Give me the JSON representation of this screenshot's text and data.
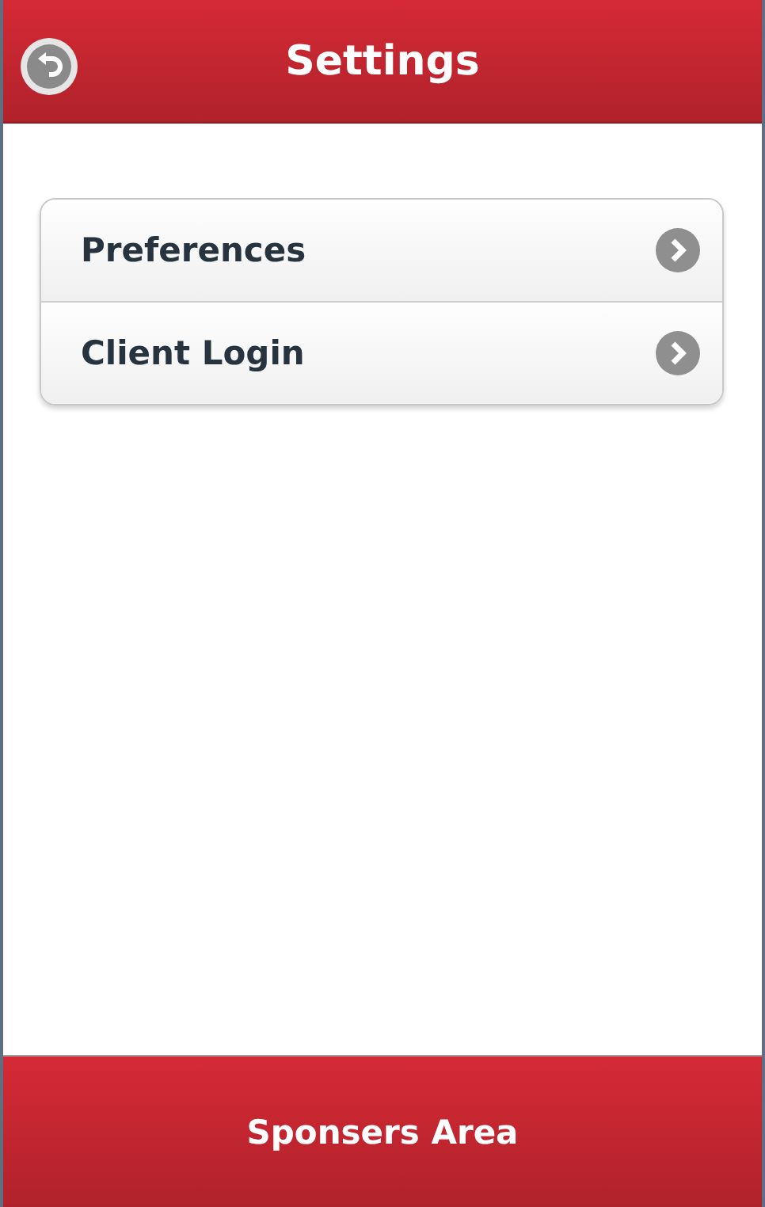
{
  "header": {
    "title": "Settings"
  },
  "menu": [
    {
      "label": "Preferences"
    },
    {
      "label": "Client Login"
    }
  ],
  "footer": {
    "label": "Sponsers Area"
  }
}
